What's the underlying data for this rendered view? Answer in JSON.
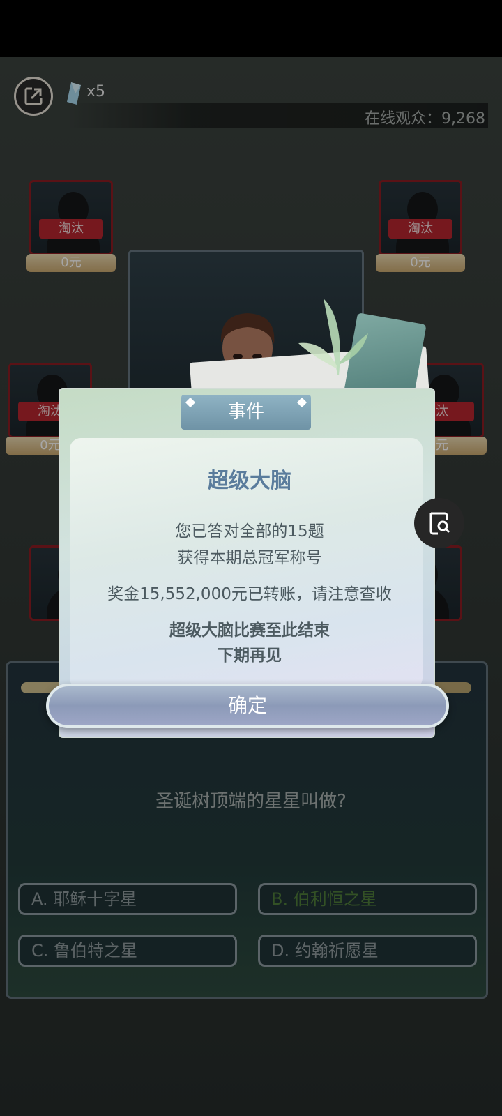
{
  "top_bar": {
    "gem_count": "x5",
    "viewer_label": "在线观众：9,268"
  },
  "contestants": [
    {
      "status": "淘汰",
      "money": "0元"
    },
    {
      "status": "淘汰",
      "money": "0元"
    },
    {
      "status": "淘汰",
      "money": "0元"
    },
    {
      "status": "汰",
      "money": "元"
    }
  ],
  "dialog": {
    "tab_title": "事件",
    "title": "超级大脑",
    "line1": "您已答对全部的15题",
    "line2": "获得本期总冠军称号",
    "line3": "奖金15,552,000元已转账，请注意查收",
    "line4": "超级大脑比赛至此结束",
    "line5": "下期再见",
    "confirm": "确定"
  },
  "question": {
    "text": "圣诞树顶端的星星叫做?",
    "answers": [
      {
        "label": "A. 耶稣十字星",
        "state": "normal"
      },
      {
        "label": "B. 伯利恒之星",
        "state": "correct"
      },
      {
        "label": "C. 鲁伯特之星",
        "state": "normal"
      },
      {
        "label": "D. 约翰祈愿星",
        "state": "normal"
      }
    ]
  },
  "colors": {
    "accent": "#5a7c9c",
    "eliminated": "#b5262e",
    "correct": "#4f7d3a"
  }
}
